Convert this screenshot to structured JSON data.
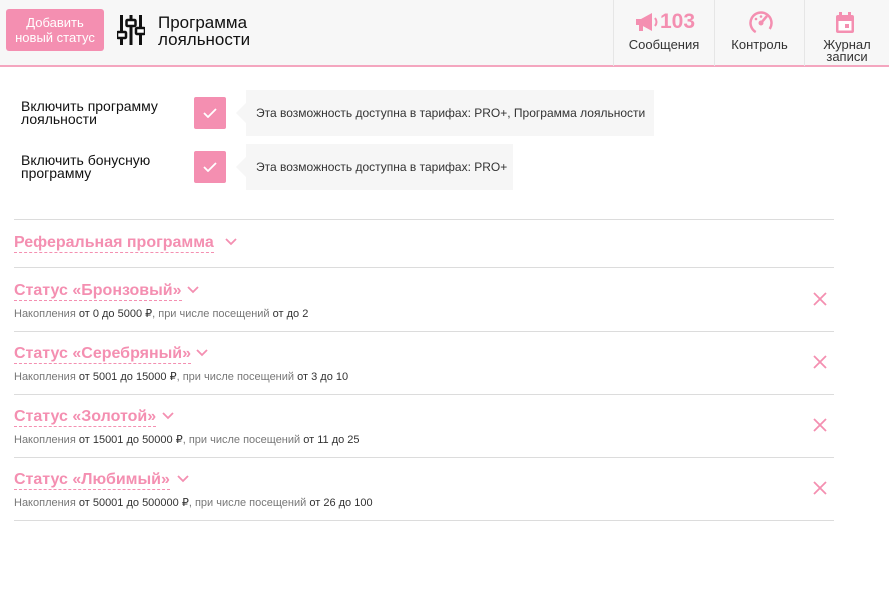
{
  "header": {
    "add_button": "Добавить новый статус",
    "title_line1": "Программа",
    "title_line2": "лояльности",
    "messages_count": "103",
    "messages_label": "Сообщения",
    "control_label": "Контроль",
    "journal_line1": "Журнал",
    "journal_line2": "записи"
  },
  "toggles": [
    {
      "label_line1": "Включить программу",
      "label_line2": "лояльности",
      "checked": true,
      "tip": "Эта возможность доступна в тарифах: PRO+, Программа лояльности"
    },
    {
      "label_line1": "Включить бонусную",
      "label_line2": "программу",
      "checked": true,
      "tip": "Эта возможность доступна в тарифах: PRO+"
    }
  ],
  "referral": {
    "title": "Реферальная программа"
  },
  "statuses": [
    {
      "title": "Статус «Бронзовый»",
      "acc_label": "Накопления",
      "acc_value": "от 0 до 5000 ₽",
      "visits_label": ", при числе посещений",
      "visits_value": "от до 2"
    },
    {
      "title": "Статус «Серебряный»",
      "acc_label": "Накопления",
      "acc_value": "от 5001 до 15000 ₽",
      "visits_label": ", при числе посещений",
      "visits_value": "от 3 до 10"
    },
    {
      "title": "Статус «Золотой»",
      "acc_label": "Накопления",
      "acc_value": "от 15001 до 50000 ₽",
      "visits_label": ", при числе посещений",
      "visits_value": "от 11 до 25"
    },
    {
      "title": "Статус «Любимый»",
      "acc_label": "Накопления",
      "acc_value": "от 50001 до 500000 ₽",
      "visits_label": ", при числе посещений",
      "visits_value": "от 26 до 100"
    }
  ],
  "colors": {
    "accent": "#f48fb1",
    "divider": "#dcdcdc",
    "tip_bg": "#f6f6f6"
  }
}
